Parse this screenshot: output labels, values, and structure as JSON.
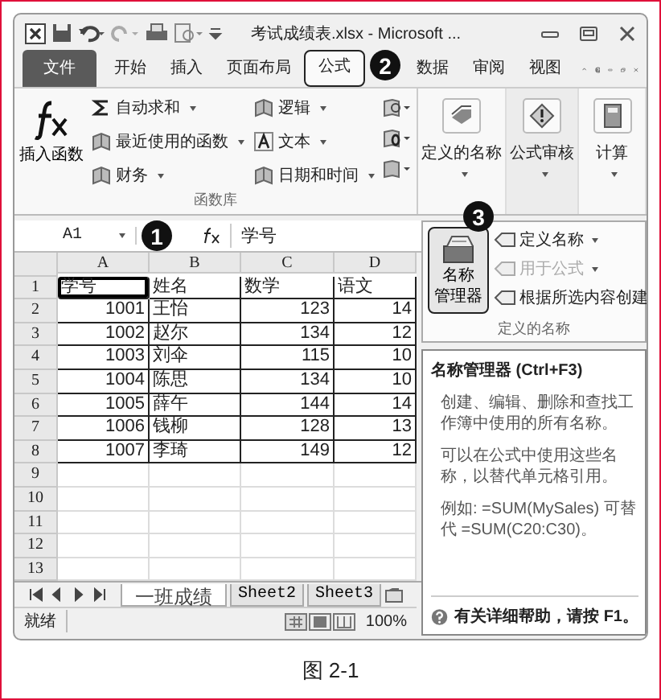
{
  "window": {
    "title": "考试成绩表.xlsx - Microsoft ..."
  },
  "tabs": [
    {
      "label": "文件",
      "kind": "file",
      "selected": false
    },
    {
      "label": "开始",
      "kind": "tab",
      "selected": false
    },
    {
      "label": "插入",
      "kind": "tab",
      "selected": false
    },
    {
      "label": "页面布局",
      "kind": "tab",
      "selected": false
    },
    {
      "label": "公式",
      "kind": "tab",
      "selected": true
    },
    {
      "label": "数据",
      "kind": "tab",
      "selected": false
    },
    {
      "label": "审阅",
      "kind": "tab",
      "selected": false
    },
    {
      "label": "视图",
      "kind": "tab",
      "selected": false
    }
  ],
  "ribbon": {
    "insert_function": "插入函数",
    "function_columns": [
      [
        {
          "label": "自动求和"
        },
        {
          "label": "最近使用的函数"
        },
        {
          "label": "财务"
        }
      ],
      [
        {
          "label": "逻辑"
        },
        {
          "label": "文本"
        },
        {
          "label": "日期和时间"
        }
      ]
    ],
    "group_label": "函数库",
    "big_buttons": [
      {
        "label": "定义的名称"
      },
      {
        "label": "公式审核"
      },
      {
        "label": "计算"
      }
    ]
  },
  "formula_bar": {
    "name_box": "A1",
    "formula": "学号"
  },
  "sheet": {
    "columns": [
      "A",
      "B",
      "C",
      "D"
    ],
    "rows": [
      {
        "header": "1",
        "kind": "heading",
        "cells": [
          {
            "text": "学号",
            "selected": true
          },
          {
            "text": "姓名",
            "selected": false
          },
          {
            "text": "数学",
            "selected": false
          },
          {
            "text": "语文",
            "selected": false
          }
        ]
      },
      {
        "header": "2",
        "kind": "data",
        "cells": [
          {
            "text": "1001",
            "selected": false
          },
          {
            "text": "王怡",
            "selected": false
          },
          {
            "text": "123",
            "selected": false
          },
          {
            "text": "14",
            "selected": false
          }
        ]
      },
      {
        "header": "3",
        "kind": "data",
        "cells": [
          {
            "text": "1002",
            "selected": false
          },
          {
            "text": "赵尔",
            "selected": false
          },
          {
            "text": "134",
            "selected": false
          },
          {
            "text": "12",
            "selected": false
          }
        ]
      },
      {
        "header": "4",
        "kind": "data",
        "cells": [
          {
            "text": "1003",
            "selected": false
          },
          {
            "text": "刘伞",
            "selected": false
          },
          {
            "text": "115",
            "selected": false
          },
          {
            "text": "10",
            "selected": false
          }
        ]
      },
      {
        "header": "5",
        "kind": "data",
        "cells": [
          {
            "text": "1004",
            "selected": false
          },
          {
            "text": "陈思",
            "selected": false
          },
          {
            "text": "134",
            "selected": false
          },
          {
            "text": "10",
            "selected": false
          }
        ]
      },
      {
        "header": "6",
        "kind": "data",
        "cells": [
          {
            "text": "1005",
            "selected": false
          },
          {
            "text": "薛午",
            "selected": false
          },
          {
            "text": "144",
            "selected": false
          },
          {
            "text": "14",
            "selected": false
          }
        ]
      },
      {
        "header": "7",
        "kind": "data",
        "cells": [
          {
            "text": "1006",
            "selected": false
          },
          {
            "text": "钱柳",
            "selected": false
          },
          {
            "text": "128",
            "selected": false
          },
          {
            "text": "13",
            "selected": false
          }
        ]
      },
      {
        "header": "8",
        "kind": "data",
        "cells": [
          {
            "text": "1007",
            "selected": false
          },
          {
            "text": "李琦",
            "selected": false
          },
          {
            "text": "149",
            "selected": false
          },
          {
            "text": "12",
            "selected": false
          }
        ]
      },
      {
        "header": "9",
        "kind": "empty"
      },
      {
        "header": "10",
        "kind": "empty"
      },
      {
        "header": "11",
        "kind": "empty"
      },
      {
        "header": "12",
        "kind": "empty"
      },
      {
        "header": "13",
        "kind": "empty"
      }
    ]
  },
  "names_panel": {
    "manager_lines": [
      "名称",
      "管理器"
    ],
    "items": [
      {
        "label": "定义名称",
        "dropdown": true,
        "disabled": false
      },
      {
        "label": "用于公式",
        "dropdown": true,
        "disabled": true
      },
      {
        "label": "根据所选内容创建",
        "dropdown": false,
        "disabled": false
      }
    ],
    "group_label": "定义的名称"
  },
  "tooltip": {
    "title": "名称管理器 (Ctrl+F3)",
    "paragraphs": [
      "创建、编辑、删除和查找工作簿中使用的所有名称。",
      "可以在公式中使用这些名称，以替代单元格引用。",
      "例如: =SUM(MySales) 可替代 =SUM(C20:C30)。"
    ],
    "help": "有关详细帮助，请按 F1。"
  },
  "sheet_tabs": [
    {
      "label": "一班成绩",
      "selected": true
    },
    {
      "label": "Sheet2",
      "selected": false
    },
    {
      "label": "Sheet3",
      "selected": false
    }
  ],
  "status_bar": {
    "text": "就绪",
    "zoom": "100%"
  },
  "callouts": [
    "1",
    "2",
    "3"
  ],
  "caption": "图 2-1"
}
